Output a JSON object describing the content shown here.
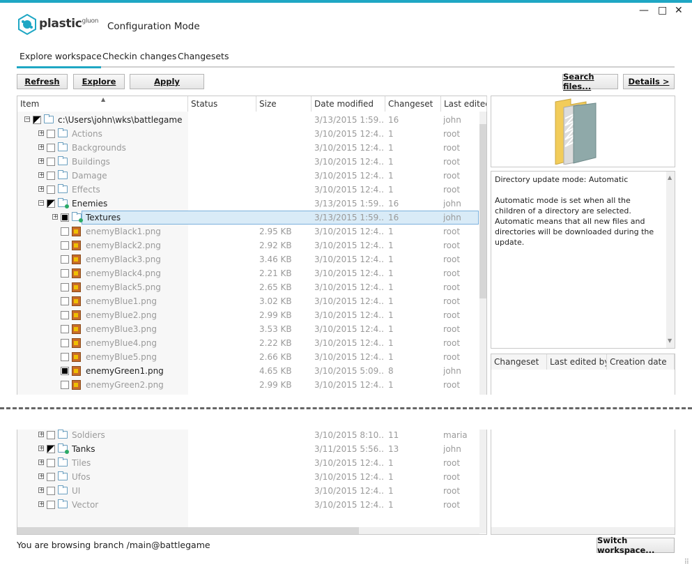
{
  "window": {
    "brand": "plastic",
    "brand_sup": "gluon",
    "mode_title": "Configuration Mode",
    "minimize": "—",
    "maximize": "□",
    "close": "✕"
  },
  "tabs": [
    "Explore workspace",
    "Checkin changes",
    "Changesets"
  ],
  "toolbar": {
    "refresh": "Refresh",
    "explore": "Explore",
    "apply": "Apply",
    "search_files": "Search files...",
    "details": "Details >"
  },
  "columns": [
    "Item",
    "Status",
    "Size",
    "Date modified",
    "Changeset",
    "Last edited"
  ],
  "rows": [
    {
      "name": "c:\\Users\\john\\wks\\battlegame",
      "size": "",
      "date": "3/13/2015 1:59...",
      "cs": "16",
      "user": "john"
    },
    {
      "name": "Actions",
      "size": "",
      "date": "3/10/2015 12:4...",
      "cs": "1",
      "user": "root"
    },
    {
      "name": "Backgrounds",
      "size": "",
      "date": "3/10/2015 12:4...",
      "cs": "1",
      "user": "root"
    },
    {
      "name": "Buildings",
      "size": "",
      "date": "3/10/2015 12:4...",
      "cs": "1",
      "user": "root"
    },
    {
      "name": "Damage",
      "size": "",
      "date": "3/10/2015 12:4...",
      "cs": "1",
      "user": "root"
    },
    {
      "name": "Effects",
      "size": "",
      "date": "3/10/2015 12:4...",
      "cs": "1",
      "user": "root"
    },
    {
      "name": "Enemies",
      "size": "",
      "date": "3/13/2015 1:59...",
      "cs": "16",
      "user": "john"
    },
    {
      "name": "Textures",
      "size": "",
      "date": "3/13/2015 1:59...",
      "cs": "16",
      "user": "john"
    },
    {
      "name": "enemyBlack1.png",
      "size": "2.95 KB",
      "date": "3/10/2015 12:4...",
      "cs": "1",
      "user": "root"
    },
    {
      "name": "enemyBlack2.png",
      "size": "2.92 KB",
      "date": "3/10/2015 12:4...",
      "cs": "1",
      "user": "root"
    },
    {
      "name": "enemyBlack3.png",
      "size": "3.46 KB",
      "date": "3/10/2015 12:4...",
      "cs": "1",
      "user": "root"
    },
    {
      "name": "enemyBlack4.png",
      "size": "2.21 KB",
      "date": "3/10/2015 12:4...",
      "cs": "1",
      "user": "root"
    },
    {
      "name": "enemyBlack5.png",
      "size": "2.65 KB",
      "date": "3/10/2015 12:4...",
      "cs": "1",
      "user": "root"
    },
    {
      "name": "enemyBlue1.png",
      "size": "3.02 KB",
      "date": "3/10/2015 12:4...",
      "cs": "1",
      "user": "root"
    },
    {
      "name": "enemyBlue2.png",
      "size": "2.99 KB",
      "date": "3/10/2015 12:4...",
      "cs": "1",
      "user": "root"
    },
    {
      "name": "enemyBlue3.png",
      "size": "3.53 KB",
      "date": "3/10/2015 12:4...",
      "cs": "1",
      "user": "root"
    },
    {
      "name": "enemyBlue4.png",
      "size": "2.22 KB",
      "date": "3/10/2015 12:4...",
      "cs": "1",
      "user": "root"
    },
    {
      "name": "enemyBlue5.png",
      "size": "2.66 KB",
      "date": "3/10/2015 12:4...",
      "cs": "1",
      "user": "root"
    },
    {
      "name": "enemyGreen1.png",
      "size": "4.65 KB",
      "date": "3/10/2015 5:09...",
      "cs": "8",
      "user": "john"
    },
    {
      "name": "enemyGreen2.png",
      "size": "2.99 KB",
      "date": "3/10/2015 12:4...",
      "cs": "1",
      "user": "root"
    }
  ],
  "rows_lower": [
    {
      "name": "Soldiers",
      "date": "3/10/2015 8:10...",
      "cs": "11",
      "user": "maria"
    },
    {
      "name": "Tanks",
      "date": "3/11/2015 5:56...",
      "cs": "13",
      "user": "john"
    },
    {
      "name": "Tiles",
      "date": "3/10/2015 12:4...",
      "cs": "1",
      "user": "root"
    },
    {
      "name": "Ufos",
      "date": "3/10/2015 12:4...",
      "cs": "1",
      "user": "root"
    },
    {
      "name": "UI",
      "date": "3/10/2015 12:4...",
      "cs": "1",
      "user": "root"
    },
    {
      "name": "Vector",
      "date": "3/10/2015 12:4...",
      "cs": "1",
      "user": "root"
    }
  ],
  "details": {
    "line1": "Directory update mode: Automatic",
    "line2": "Automatic mode is set when all the children of a directory are selected.",
    "line3": "Automatic means that all new files and directories will be downloaded during the update."
  },
  "history_columns": [
    "Changeset",
    "Last edited by",
    "Creation date"
  ],
  "footer": {
    "branch": "You are browsing branch /main@battlegame",
    "switch": "Switch workspace..."
  }
}
